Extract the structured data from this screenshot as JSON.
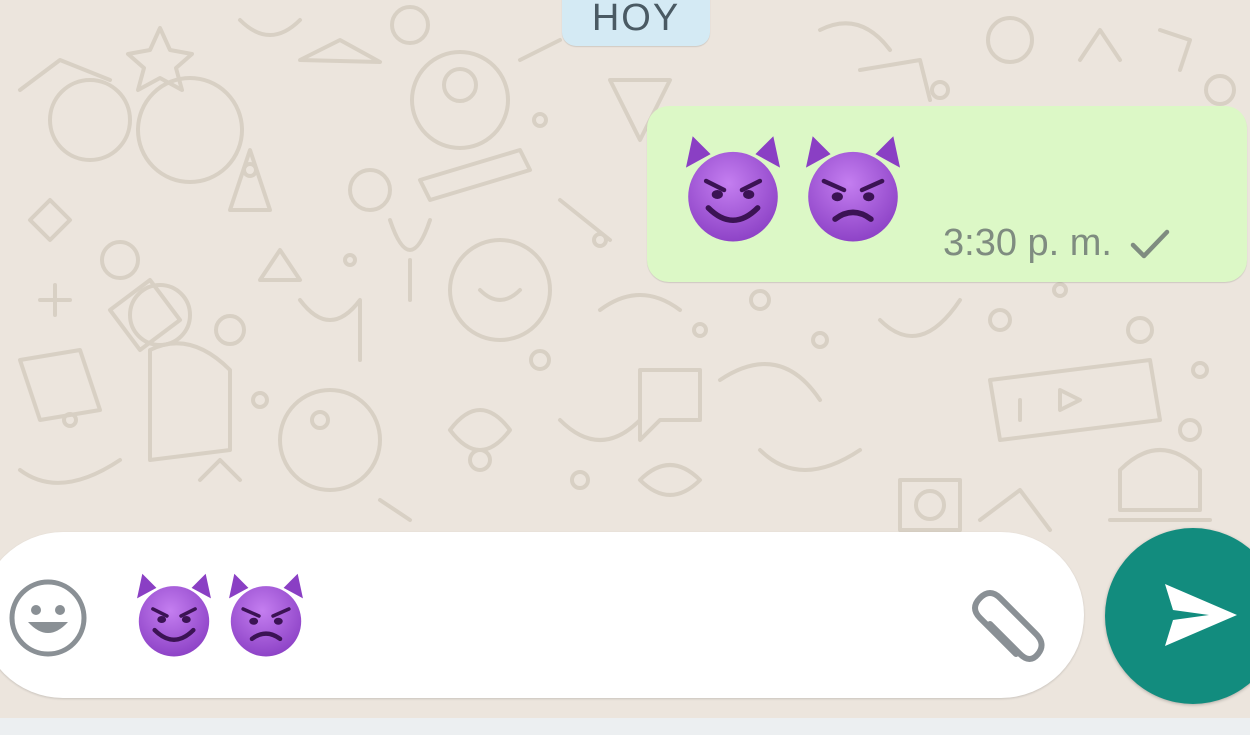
{
  "chat": {
    "date_chip": "HOY",
    "message": {
      "emojis": [
        "smiling-face-with-horns",
        "angry-face-with-horns"
      ],
      "time": "3:30 p. m.",
      "status_icon": "single-check-icon"
    }
  },
  "composer": {
    "emoji_button_icon": "smiley-icon",
    "draft_emojis": [
      "smiling-face-with-horns",
      "angry-face-with-horns"
    ],
    "attach_icon": "paperclip-icon",
    "send_icon": "send-arrow-icon"
  },
  "colors": {
    "background": "#ece5dd",
    "outgoing_bubble": "#dcf8c6",
    "date_chip": "#d4eaf4",
    "send_button": "#128c7e",
    "emoji_purple": "#9b4fd1"
  }
}
